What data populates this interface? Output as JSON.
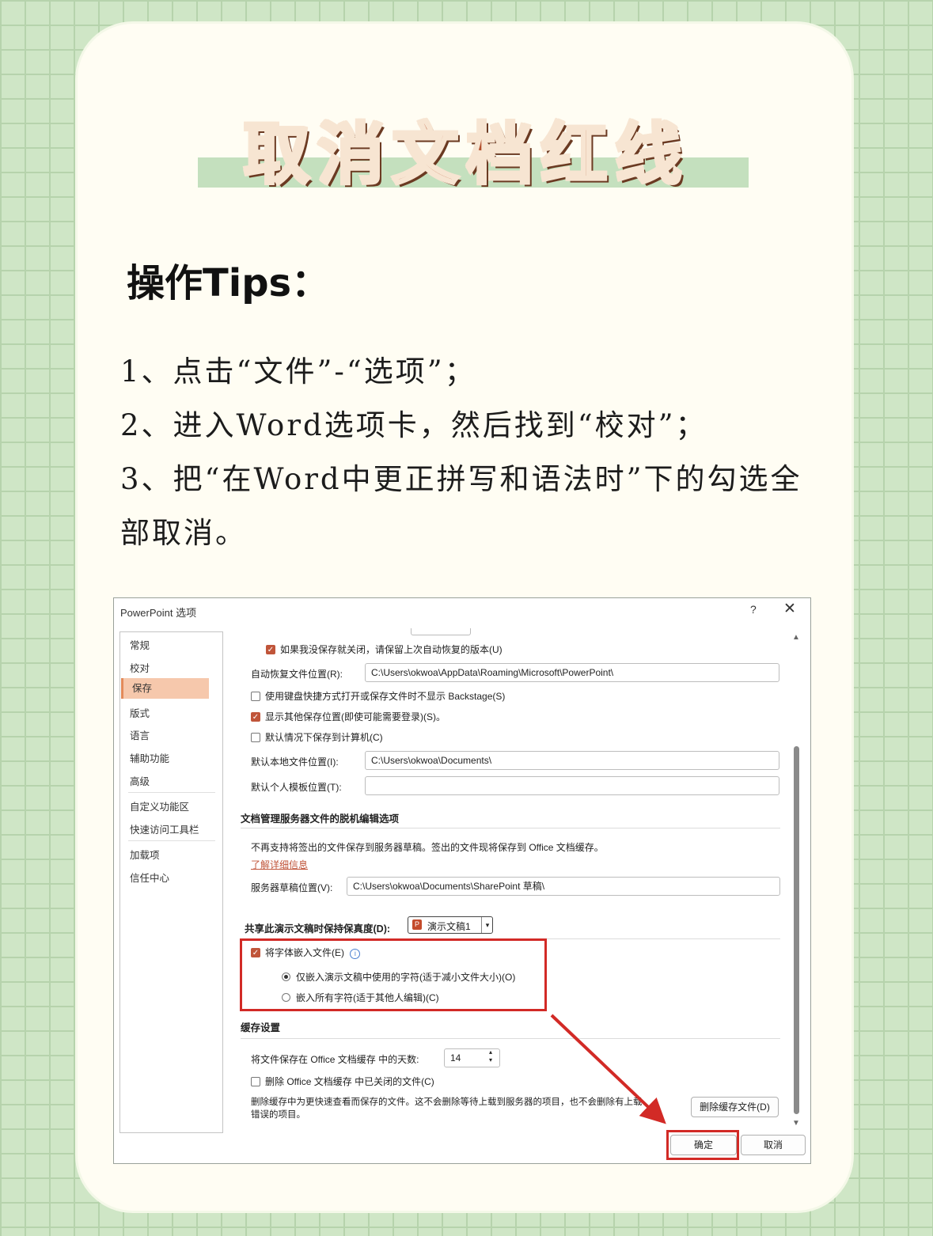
{
  "title": "取消文档红线",
  "tips_heading": "操作Tips：",
  "steps": [
    "1、点击“文件”-“选项”；",
    "2、进入Word选项卡，然后找到“校对”；",
    "3、把“在Word中更正拼写和语法时”下的勾选全部取消。"
  ],
  "dialog": {
    "title": "PowerPoint 选项",
    "help": "?",
    "close": "✕",
    "nav": [
      "常规",
      "校对",
      "保存",
      "版式",
      "语言",
      "辅助功能",
      "高级",
      "自定义功能区",
      "快速访问工具栏",
      "加载项",
      "信任中心"
    ],
    "nav_selected": "保存",
    "opt_keep_last_version": "如果我没保存就关闭，请保留上次自动恢复的版本(U)",
    "autorecover_label": "自动恢复文件位置(R):",
    "autorecover_path": "C:\\Users\\okwoa\\AppData\\Roaming\\Microsoft\\PowerPoint\\",
    "opt_no_backstage": "使用键盘快捷方式打开或保存文件时不显示 Backstage(S)",
    "opt_show_more_locations": "显示其他保存位置(即使可能需要登录)(S)。",
    "opt_save_to_computer": "默认情况下保存到计算机(C)",
    "default_local_label": "默认本地文件位置(I):",
    "default_local_path": "C:\\Users\\okwoa\\Documents\\",
    "personal_template_label": "默认个人模板位置(T):",
    "personal_template_path": "",
    "offline_section": "文档管理服务器文件的脱机编辑选项",
    "offline_note": "不再支持将签出的文件保存到服务器草稿。签出的文件现将保存到 Office 文档缓存。",
    "learn_more": "了解详细信息",
    "server_drafts_label": "服务器草稿位置(V):",
    "server_drafts_path": "C:\\Users\\okwoa\\Documents\\SharePoint 草稿\\",
    "fidelity_label": "共享此演示文稿时保持保真度(D):",
    "fidelity_doc": "演示文稿1",
    "opt_embed_fonts": "将字体嵌入文件(E)",
    "radio_embed_used": "仅嵌入演示文稿中使用的字符(适于减小文件大小)(O)",
    "radio_embed_all": "嵌入所有字符(适于其他人编辑)(C)",
    "cache_section": "缓存设置",
    "cache_days_label": "将文件保存在 Office 文档缓存 中的天数:",
    "cache_days": "14",
    "opt_delete_closed": "删除 Office 文档缓存 中已关闭的文件(C)",
    "cache_note_1": "删除缓存中为更快速查看而保存的文件。这不会删除等待上载到服务器的项目，也不会删除有上载",
    "cache_note_2": "错误的项目。",
    "delete_cache_button": "删除缓存文件(D)",
    "ok_button": "确定",
    "cancel_button": "取消"
  },
  "colors": {
    "accent": "#c0553a",
    "highlight": "#d22a26",
    "title_text": "#b24d2b"
  }
}
